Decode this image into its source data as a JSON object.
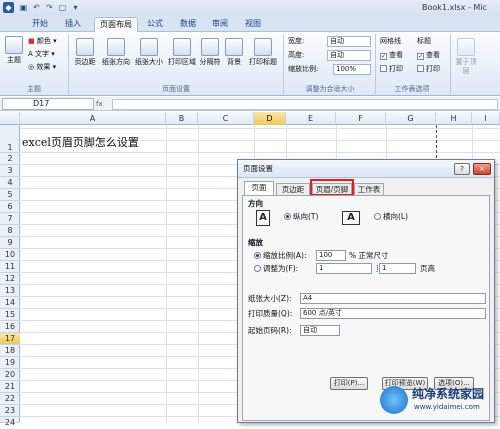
{
  "window": {
    "title": "Book1.xlsx - Mic"
  },
  "ribbon_tabs": [
    "开始",
    "插入",
    "页面布局",
    "公式",
    "数据",
    "审阅",
    "视图"
  ],
  "ribbon": {
    "theme": {
      "button": "主题",
      "colors": "颜色",
      "fonts": "文字",
      "effects": "效果",
      "group": "主题"
    },
    "page_setup": {
      "margins": "页边距",
      "orientation": "纸张方向",
      "size": "纸张大小",
      "print_area": "打印区域",
      "breaks": "分隔符",
      "background": "背景",
      "print_titles": "打印标题",
      "group": "页面设置"
    },
    "scale": {
      "width_label": "宽度:",
      "width_value": "自动",
      "height_label": "高度:",
      "height_value": "自动",
      "scale_label": "缩放比例:",
      "scale_value": "100%",
      "group": "调整为合适大小"
    },
    "sheet_options": {
      "gridlines": "网格线",
      "headings": "标题",
      "view": "查看",
      "print": "打印",
      "group": "工作表选项"
    },
    "arrange": {
      "bring_forward": "置于顶层"
    }
  },
  "formula_bar": {
    "name_box": "D17",
    "fx": "fx"
  },
  "columns": [
    "A",
    "B",
    "C",
    "D",
    "E",
    "F",
    "G",
    "H",
    "I"
  ],
  "rows": [
    "1",
    "2",
    "3",
    "4",
    "5",
    "6",
    "7",
    "8",
    "9",
    "10",
    "11",
    "12",
    "13",
    "14",
    "15",
    "16",
    "17",
    "18",
    "19",
    "20",
    "21",
    "22",
    "23",
    "24"
  ],
  "cell_A1": "excel页眉页脚怎么设置",
  "dialog": {
    "title": "页面设置",
    "help": "?",
    "close": "×",
    "tabs": [
      "页面",
      "页边距",
      "页眉/页脚",
      "工作表"
    ],
    "orientation_label": "方向",
    "portrait": "纵向(T)",
    "landscape": "横向(L)",
    "scaling_label": "缩放",
    "scale_adjust": "缩放比例(A):",
    "scale_value": "100",
    "normal_size": "% 正常尺寸",
    "fit_to": "调整为(F):",
    "fit_wide": "1",
    "pages_wide": "页宽",
    "fit_tall": "1",
    "pages_tall": "页高",
    "paper_size_label": "纸张大小(Z):",
    "paper_size": "A4",
    "print_quality_label": "打印质量(Q):",
    "print_quality": "600 点/英寸",
    "first_page_label": "起始页码(R):",
    "first_page": "自动",
    "print_button": "打印(P)...",
    "preview_button": "打印预览(W)",
    "options_button": "选项(O)..."
  },
  "watermark": {
    "title": "纯净系统家园",
    "url": "www.yidaimei.com"
  }
}
